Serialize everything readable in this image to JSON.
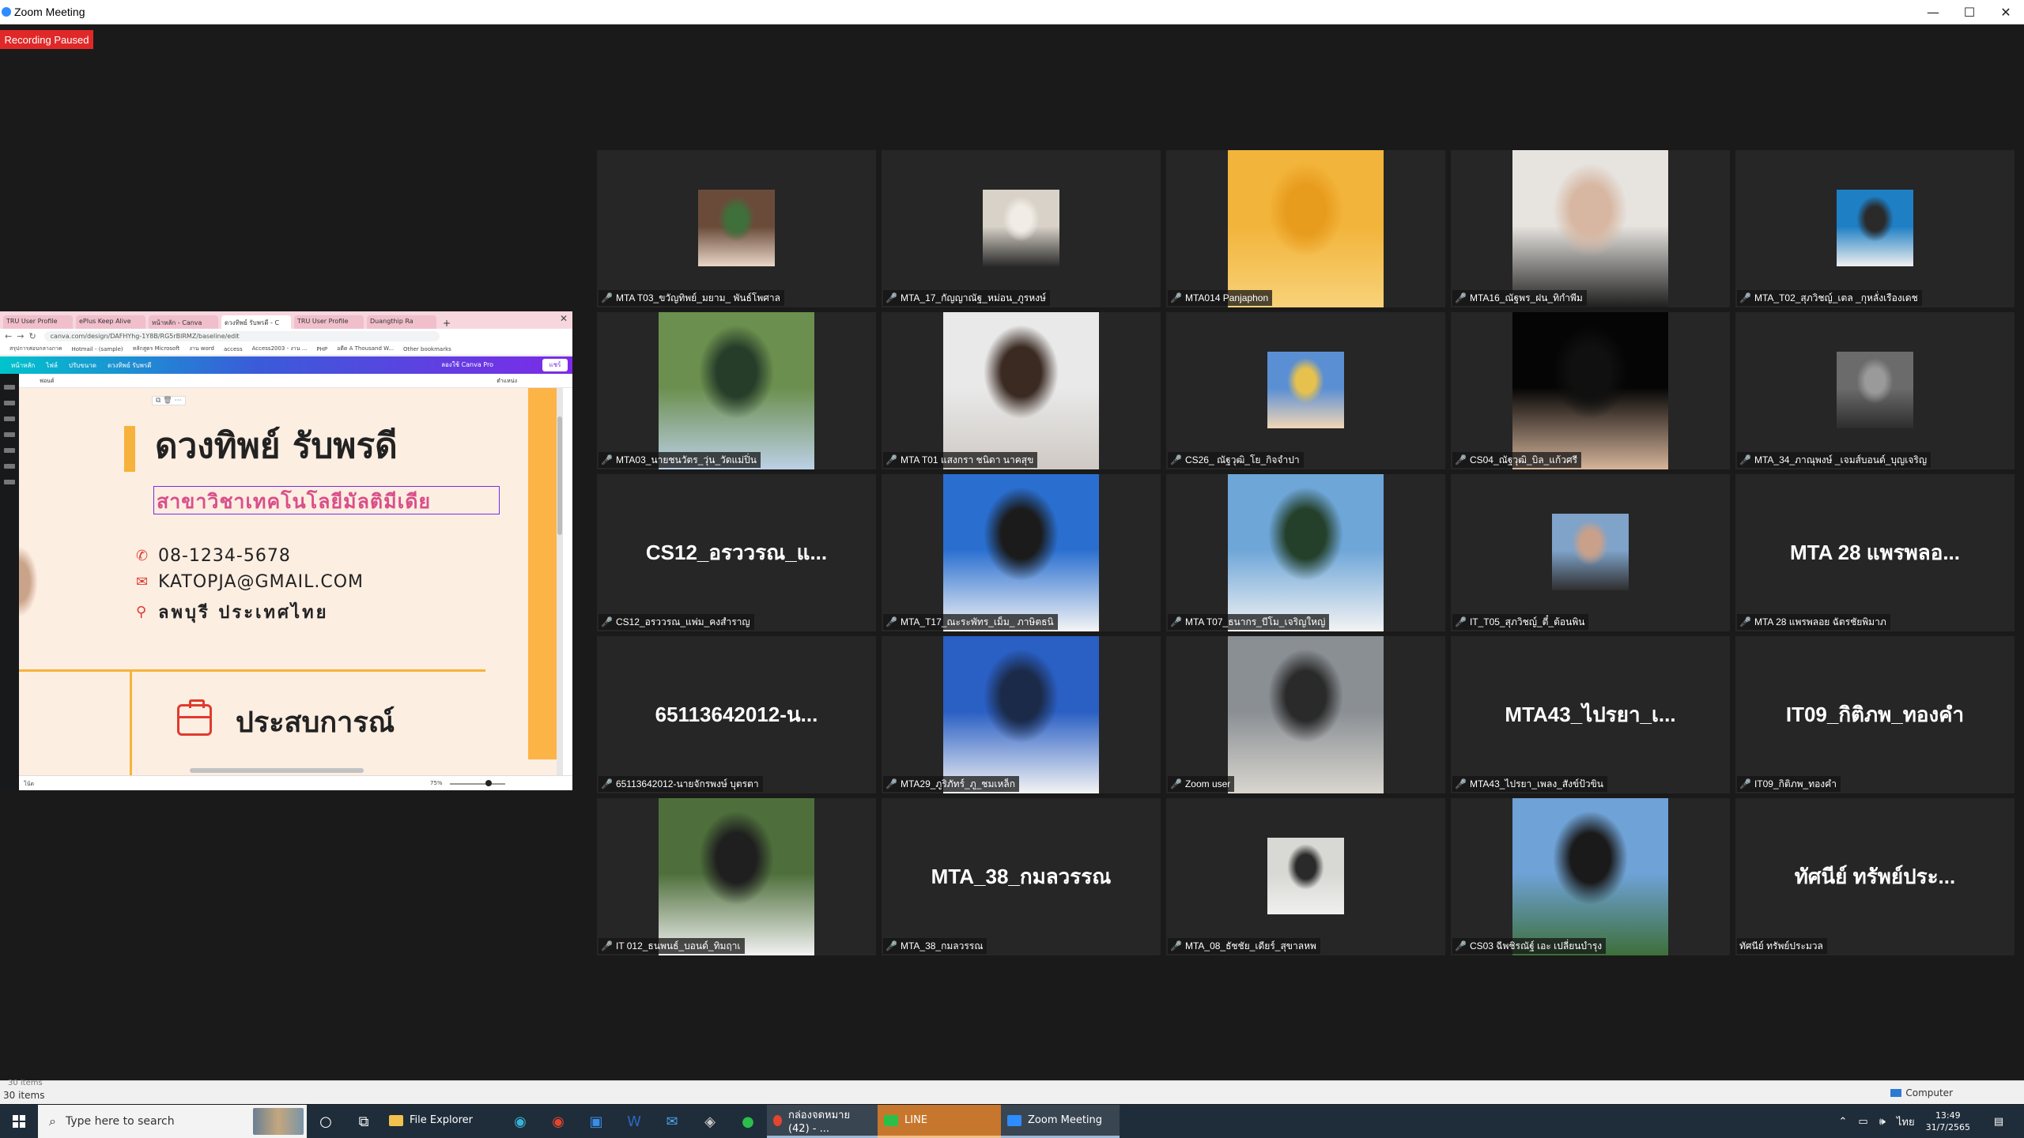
{
  "window": {
    "title": "Zoom Meeting",
    "controls": [
      "—",
      "☐",
      "✕"
    ]
  },
  "recording": {
    "label": "Recording Paused",
    "color": "#e02828"
  },
  "shared_screen": {
    "browser_tabs": [
      "TRU User Profile",
      "ePlus Keep Alive",
      "หน้าหลัก - Canva",
      "ดวงทิพย์ รับพรดี - C",
      "TRU User Profile",
      "Duangthip Ra"
    ],
    "new_tab": "+",
    "url": "canva.com/design/DAFHYhg-1Y8B/RG5rBlRMZ/baseline/edit",
    "bookmarks": [
      "สรุปการสอบกลางภาค",
      "Hotmail - (sample)",
      "หลักสูตร Microsoft",
      "งาน word",
      "access",
      "Access2003 - งาน ...",
      "PHP",
      "อดีต A Thousand W...",
      "Other bookmarks"
    ],
    "canva_menu": [
      "หน้าหลัก",
      "ไฟล์",
      "ปรับขนาด",
      "ดวงทิพย์ รับพรดี"
    ],
    "canva_upgrade": "ลองใช้ Canva Pro",
    "canva_share": "แชร์",
    "toolbar_left": "ฟอนต์",
    "toolbar_right": "ตำแหน่ง",
    "resume": {
      "name": "ดวงทิพย์ รับพรดี",
      "subtitle": "สาขาวิชาเทคโนโลยีมัลติมีเดีย",
      "phone": "08-1234-5678",
      "email": "KATOPJA@GMAIL.COM",
      "location": "ลพบุรี ประเทศไทย",
      "section_heading": "ประสบการณ์"
    },
    "notes_label": "โน้ต",
    "zoom_percent": "75%"
  },
  "participants": [
    {
      "name": "MTA T03_ขวัญทิพย์_มยาม_ พันธ์โพศาล",
      "type": "photo",
      "photo": "small",
      "colors": [
        "#6a4b3a",
        "#e9d6c7",
        "#3f6f3a"
      ]
    },
    {
      "name": "MTA_17_กัญญาณัฐ_หม่อน_ภูรหงษ์",
      "type": "photo",
      "photo": "small",
      "colors": [
        "#d8d2c8",
        "#2b2b2b",
        "#f1ede6"
      ]
    },
    {
      "name": "MTA014 Panjaphon",
      "type": "photo",
      "photo": "big",
      "colors": [
        "#f2b43a",
        "#f8d27a",
        "#e89c1e"
      ]
    },
    {
      "name": "MTA16_ณัฐพร_ฝน_ทิกำพีม",
      "type": "photo",
      "photo": "big",
      "colors": [
        "#e7e4e0",
        "#1f1f1f",
        "#d7b7a2"
      ]
    },
    {
      "name": "MTA_T02_สุภวิชญ์_เตล _กุหลั่งเรืองเดช",
      "type": "photo",
      "photo": "small",
      "colors": [
        "#1e7fc4",
        "#f0f0f0",
        "#2a2a2a"
      ]
    },
    {
      "name": "MTA03_นายชนวัตร_วุ่น_วัดแม่ปิ่น",
      "type": "photo",
      "photo": "big",
      "colors": [
        "#6b8f4e",
        "#bcd0e6",
        "#263d2a"
      ]
    },
    {
      "name": "MTA T01 แสงกรา ชนิดา นาคสุข",
      "type": "photo",
      "photo": "big",
      "colors": [
        "#e9e9e9",
        "#cfc9c4",
        "#3a2a22"
      ]
    },
    {
      "name": "CS26_ ณัฐวุฒิ_โย_กิจจำปา",
      "type": "photo",
      "photo": "small",
      "colors": [
        "#5b8fd4",
        "#f3d7b5",
        "#e6c14e"
      ]
    },
    {
      "name": "CS04_ณัฐวุฒิ_บิล_แก้วศรี",
      "type": "photo",
      "photo": "big",
      "colors": [
        "#050505",
        "#d6b49a",
        "#101010"
      ]
    },
    {
      "name": "MTA_34_ภาณุพงษ์ _เจมส์บอนด์_บุญเจริญ",
      "type": "photo",
      "photo": "small",
      "colors": [
        "#6b6b6b",
        "#2d2d2d",
        "#9a9a9a"
      ]
    },
    {
      "name": "CS12_อรววรณ_แพ่ม_คงสำราญ",
      "type": "name",
      "display": "CS12_อรววรณ_แ..."
    },
    {
      "name": "MTA_T17_ณะระพัทร_เม็ม_ ภาษิตธนิ",
      "type": "photo",
      "photo": "big",
      "colors": [
        "#2a6fd0",
        "#f5f5f5",
        "#1b1b1b"
      ]
    },
    {
      "name": "MTA T07_ธนากร_บีโม_เจริญใหญ่",
      "type": "photo",
      "photo": "big",
      "colors": [
        "#6ea6d8",
        "#f3f3f3",
        "#24402a"
      ]
    },
    {
      "name": "IT_T05_สุภวิชญ์_ตี๋_ต้อนพิน",
      "type": "photo",
      "photo": "small",
      "colors": [
        "#7fa3c9",
        "#2e2e2e",
        "#c9a08a"
      ]
    },
    {
      "name": "MTA 28 แพรพลอย ฉัตรชัยพิมาภ",
      "type": "name",
      "display": "MTA 28 แพรพลอ..."
    },
    {
      "name": "65113642012-นายจักรพงษ์ บุตรตา",
      "type": "name",
      "display": "65113642012-น..."
    },
    {
      "name": "MTA29_ภูริภัทร์_ภู_ชมเหล็ก",
      "type": "photo",
      "photo": "big",
      "colors": [
        "#2a5fc4",
        "#f4f4f4",
        "#1b2a48"
      ]
    },
    {
      "name": "Zoom user",
      "type": "photo",
      "photo": "big",
      "colors": [
        "#8a8f94",
        "#d9d6cf",
        "#2a2a2a"
      ]
    },
    {
      "name": "MTA43_ไปรยา_เพลง_สังข์ป้วขิน",
      "type": "name",
      "display": "MTA43_ไปรยา_เ..."
    },
    {
      "name": "IT09_กิติภพ_ทองคำ",
      "type": "name",
      "display": "IT09_กิติภพ_ทองคำ"
    },
    {
      "name": "IT 012_ธนพนธ์_บอนด์_ทิมฤาเ",
      "type": "photo",
      "photo": "big",
      "colors": [
        "#4e6f3b",
        "#f2f2f2",
        "#1f1f1f"
      ]
    },
    {
      "name": "MTA_38_กมลวรรณ",
      "type": "name",
      "display": "MTA_38_กมลวรรณ"
    },
    {
      "name": "MTA_08_ธัชชัย_เดียร์_สุขาลหพ",
      "type": "photo",
      "photo": "small",
      "colors": [
        "#d8d8d4",
        "#f0f0f0",
        "#2a2a2a"
      ]
    },
    {
      "name": "CS03 ฉีพชิรณัฐ์ เอะ เปลี่ยนบำรุง",
      "type": "photo",
      "photo": "big",
      "colors": [
        "#6fa2d6",
        "#3d6f3a",
        "#1a1a1a"
      ]
    },
    {
      "name": "ทัศนีย์ ทรัพย์ประมวล",
      "type": "name",
      "display": "ทัศนีย์ ทรัพย์ประ..."
    }
  ],
  "statusbar": {
    "items_count": "30 items",
    "ghost": "30 items",
    "computer": "Computer"
  },
  "taskbar": {
    "search_placeholder": "Type here to search",
    "file_explorer": "File Explorer",
    "chrome_item": "กล่องจดหมาย (42) - ...",
    "line_item": "LINE",
    "zoom_item": "Zoom Meeting",
    "time": "13:49",
    "date": "31/7/2565",
    "lang": "ไทย"
  }
}
